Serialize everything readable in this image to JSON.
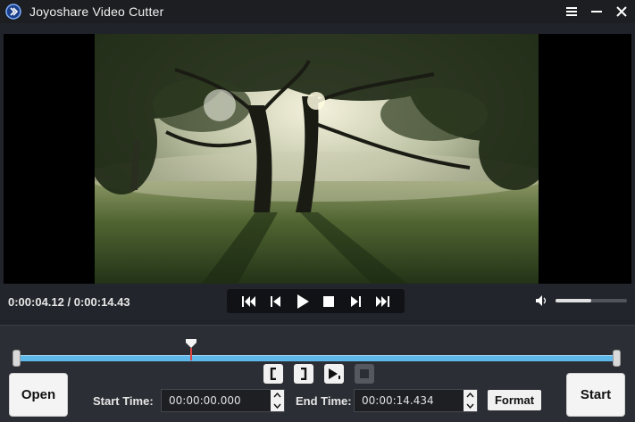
{
  "window": {
    "title": "Joyoshare Video Cutter",
    "menu_icon": "hamburger-menu-icon",
    "minimize_icon": "minimize-icon",
    "close_icon": "close-icon"
  },
  "player": {
    "time_readout": "0:00:04.12 / 0:00:14.43",
    "volume_level": 0.5,
    "buttons": [
      "skip-back-icon",
      "step-back-icon",
      "play-icon",
      "stop-icon",
      "step-forward-icon",
      "skip-forward-icon"
    ]
  },
  "timeline": {
    "playhead_position": 0.29
  },
  "segment_controls": [
    "mark-start-icon",
    "mark-end-icon",
    "preview-segment-icon",
    "stop-segment-icon"
  ],
  "bottom": {
    "open_label": "Open",
    "start_label": "Start",
    "start_time_label": "Start Time:",
    "start_time_value": "00:00:00.000",
    "end_time_label": "End Time:",
    "end_time_value": "00:00:14.434",
    "format_label": "Format"
  },
  "colors": {
    "accent": "#5fb8ea",
    "background": "#202329",
    "panel": "#2b2e34"
  }
}
